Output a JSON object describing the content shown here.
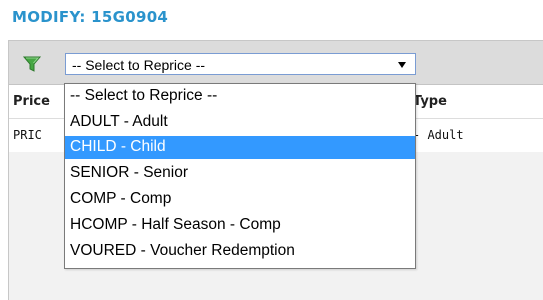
{
  "header": {
    "title": "MODIFY:  15G0904"
  },
  "toolbar": {
    "filter_icon": "funnel-filter-icon",
    "reprice_select": {
      "value": "-- Select to Reprice --"
    }
  },
  "grid": {
    "columns": {
      "price": "Price",
      "type": "Type"
    },
    "rows": [
      {
        "price": "PRIC",
        "type": "- Adult"
      }
    ]
  },
  "dropdown": {
    "options": [
      "-- Select to Reprice --",
      "ADULT - Adult",
      "CHILD - Child",
      "SENIOR - Senior",
      "COMP - Comp",
      "HCOMP - Half Season - Comp",
      "VOURED - Voucher Redemption"
    ],
    "highlighted": "CHILD - Child"
  },
  "colors": {
    "title_blue": "#2a93cc",
    "highlight_blue": "#3399ff",
    "funnel_green": "#46a743"
  }
}
